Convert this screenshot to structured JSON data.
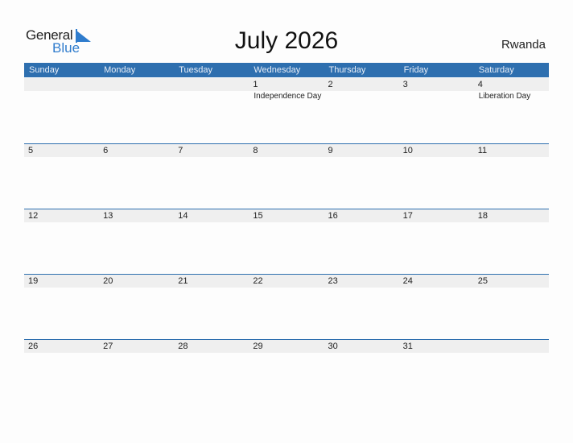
{
  "logo": {
    "line1": "General",
    "line2": "Blue"
  },
  "title": "July 2026",
  "country": "Rwanda",
  "weekdays": [
    "Sunday",
    "Monday",
    "Tuesday",
    "Wednesday",
    "Thursday",
    "Friday",
    "Saturday"
  ],
  "weeks": [
    {
      "days": [
        "",
        "",
        "",
        "1",
        "2",
        "3",
        "4"
      ],
      "holidays": [
        "",
        "",
        "",
        "Independence Day",
        "",
        "",
        "Liberation Day"
      ]
    },
    {
      "days": [
        "5",
        "6",
        "7",
        "8",
        "9",
        "10",
        "11"
      ],
      "holidays": [
        "",
        "",
        "",
        "",
        "",
        "",
        ""
      ]
    },
    {
      "days": [
        "12",
        "13",
        "14",
        "15",
        "16",
        "17",
        "18"
      ],
      "holidays": [
        "",
        "",
        "",
        "",
        "",
        "",
        ""
      ]
    },
    {
      "days": [
        "19",
        "20",
        "21",
        "22",
        "23",
        "24",
        "25"
      ],
      "holidays": [
        "",
        "",
        "",
        "",
        "",
        "",
        ""
      ]
    },
    {
      "days": [
        "26",
        "27",
        "28",
        "29",
        "30",
        "31",
        ""
      ],
      "holidays": [
        "",
        "",
        "",
        "",
        "",
        "",
        ""
      ]
    }
  ],
  "colors": {
    "accent": "#2e6faf",
    "logo_blue": "#2f7ccd",
    "band": "#efefef"
  }
}
